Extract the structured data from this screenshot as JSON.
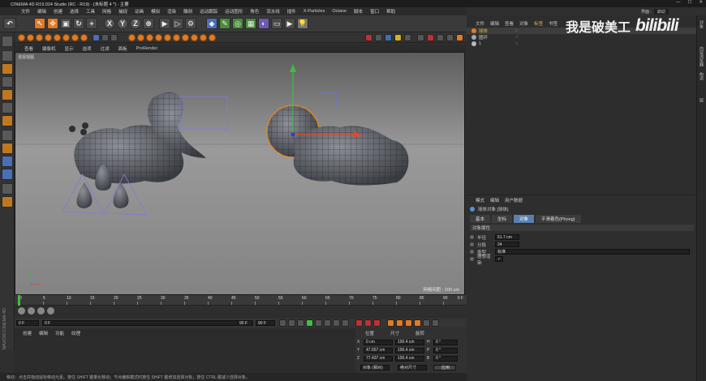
{
  "window": {
    "title": "CINEMA 4D R19.024 Studio (RC - R19) - [未标题 4 *] - 主要"
  },
  "menu": [
    "文件",
    "编辑",
    "创建",
    "选择",
    "工具",
    "网格",
    "捕捉",
    "动画",
    "模拟",
    "渲染",
    "雕刻",
    "运动跟踪",
    "运动图形",
    "角色",
    "流水线",
    "插件",
    "X-Particles",
    "Octane",
    "脚本",
    "窗口",
    "帮助"
  ],
  "viewport_menu": [
    "查看",
    "摄像机",
    "显示",
    "选项",
    "过滤",
    "面板",
    "ProRender"
  ],
  "viewport": {
    "label": "透视视图",
    "grid_spacing": "网格间距 : 100 cm"
  },
  "timeline": {
    "ticks": [
      "0",
      "5",
      "10",
      "15",
      "20",
      "25",
      "30",
      "35",
      "40",
      "45",
      "50",
      "55",
      "60",
      "65",
      "70",
      "75",
      "80",
      "85",
      "90"
    ],
    "current_frame": "0 F"
  },
  "playback": {
    "start": "0 F",
    "current": "0 F",
    "end_a": "90 F",
    "end_b": "90 F"
  },
  "material_menu": [
    "创建",
    "编辑",
    "功能",
    "纹理"
  ],
  "coords": {
    "headers": [
      "位置",
      "尺寸",
      "旋转"
    ],
    "rows": [
      {
        "axis": "X",
        "pos": "0 cm",
        "size": "100.4 cm",
        "rot_label": "H",
        "rot": "0 °"
      },
      {
        "axis": "Y",
        "pos": "47.657 cm",
        "size": "100.4 cm",
        "rot_label": "P",
        "rot": "0 °"
      },
      {
        "axis": "Z",
        "pos": "77.437 cm",
        "size": "100.4 cm",
        "rot_label": "B",
        "rot": "0 °"
      }
    ],
    "mode": "对象 (相对)",
    "size_mode": "绝对尺寸",
    "apply": "应用"
  },
  "status": "移动：点击并拖动鼠标移动元素。按住 SHIFT 键量化移动；节点编辑模式时按住 SHIFT 键增加选择对象；按住 CTRL 键减少选择对象。",
  "object_manager": {
    "tabs": [
      "文件",
      "编辑",
      "查看",
      "对象",
      "标签",
      "书签"
    ],
    "objects": [
      {
        "name": "球体",
        "color": "#e07b24"
      },
      {
        "name": "圆环",
        "color": "#9ab"
      },
      {
        "name": "1",
        "color": "#bbb"
      }
    ]
  },
  "attribute_manager": {
    "tabs": [
      "模式",
      "编辑",
      "用户数据"
    ],
    "object_title": "球体对象 [球体]",
    "subtabs": [
      "基本",
      "坐标",
      "对象",
      "平滑着色(Phong)"
    ],
    "section": "对象属性",
    "fields": [
      {
        "label": "半径",
        "value": "51.7 cm"
      },
      {
        "label": "分段",
        "value": "24"
      },
      {
        "label": "类型",
        "value": "标准"
      },
      {
        "label": "理想渲染",
        "value": "✓"
      }
    ]
  },
  "right_strip": [
    "对象",
    "内容浏览器",
    "构造",
    "层"
  ],
  "watermark": {
    "text": "我是破美工",
    "logo": "bilibili"
  },
  "brand": {
    "vertical": "MAXON CINEMA 4D"
  },
  "topright": {
    "label": "界面 :",
    "value": "启动"
  }
}
